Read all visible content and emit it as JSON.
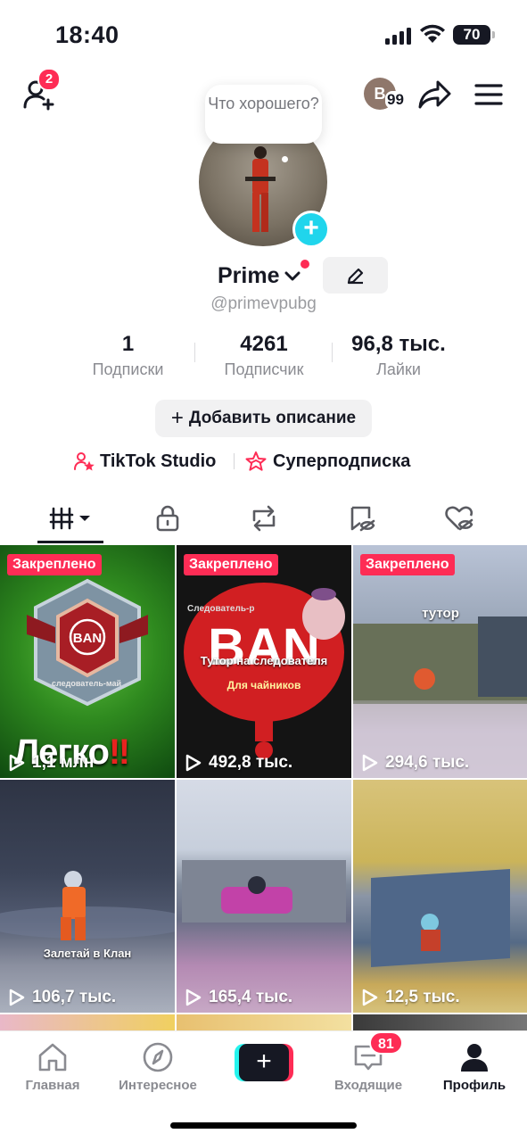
{
  "status_bar": {
    "time": "18:40",
    "battery": "70"
  },
  "header": {
    "friend_requests_badge": "2",
    "visitor_initial": "B",
    "visitor_count": "99",
    "icons": [
      "add-friend-icon",
      "share-icon",
      "menu-icon"
    ]
  },
  "profile": {
    "bubble_text": "Что хорошего?",
    "name": "Prime",
    "handle": "@primevpubg"
  },
  "stats": [
    {
      "value": "1",
      "label": "Подписки"
    },
    {
      "value": "4261",
      "label": "Подписчик"
    },
    {
      "value": "96,8 тыс.",
      "label": "Лайки"
    }
  ],
  "actions": {
    "add_description": "Добавить описание",
    "plus": "+",
    "tiktok_studio": "TikTok Studio",
    "supersubscription": "Суперподписка"
  },
  "tabs": [
    "videos-tab",
    "private-tab",
    "reposts-tab",
    "favorites-tab",
    "liked-tab"
  ],
  "videos": [
    {
      "pinned": "Закреплено",
      "views": "1,1 млн",
      "overlay": "Легко",
      "overlay2": "‼",
      "badge": "следователь-май"
    },
    {
      "pinned": "Закреплено",
      "views": "492,8 тыс.",
      "overlay": "BAN",
      "overlay2": "Тутор на следователя",
      "overlay3": "Для чайников",
      "badge": "Следователь-р"
    },
    {
      "pinned": "Закреплено",
      "views": "294,6 тыс.",
      "overlay": "тутор"
    },
    {
      "pinned": "",
      "views": "106,7 тыс.",
      "overlay": "Залетай в Клан"
    },
    {
      "pinned": "",
      "views": "165,4 тыс."
    },
    {
      "pinned": "",
      "views": "12,5 тыс."
    }
  ],
  "nav": {
    "home": "Главная",
    "discover": "Интересное",
    "create": "+",
    "inbox": "Входящие",
    "inbox_badge": "81",
    "profile": "Профиль"
  },
  "colors": {
    "accent": "#fe2c55",
    "cyan": "#25f4ee",
    "text": "#161823",
    "muted": "#8a8b91"
  }
}
